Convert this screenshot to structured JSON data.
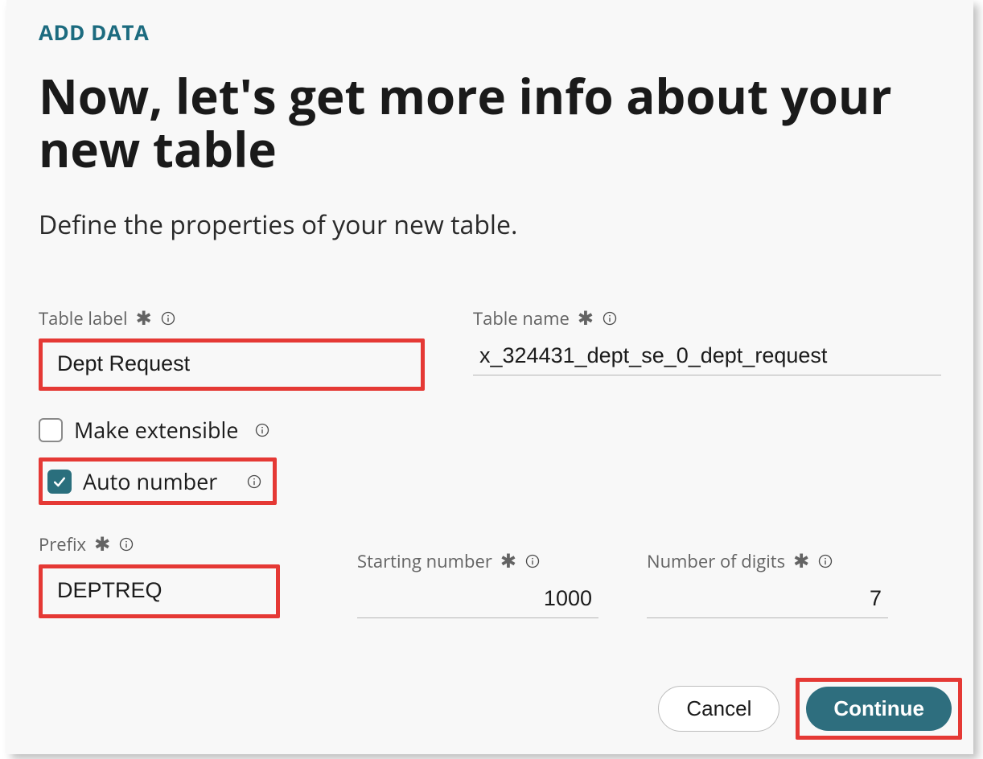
{
  "section_label": "ADD DATA",
  "heading": "Now, let's get more info about your new table",
  "subheading": "Define the properties of your new table.",
  "fields": {
    "table_label": {
      "label": "Table label",
      "value": "Dept Request"
    },
    "table_name": {
      "label": "Table name",
      "value": "x_324431_dept_se_0_dept_request"
    },
    "make_extensible": {
      "label": "Make extensible",
      "checked": false
    },
    "auto_number": {
      "label": "Auto number",
      "checked": true
    },
    "prefix": {
      "label": "Prefix",
      "value": "DEPTREQ"
    },
    "starting_number": {
      "label": "Starting number",
      "value": "1000"
    },
    "number_of_digits": {
      "label": "Number of digits",
      "value": "7"
    }
  },
  "buttons": {
    "cancel": "Cancel",
    "continue": "Continue"
  }
}
